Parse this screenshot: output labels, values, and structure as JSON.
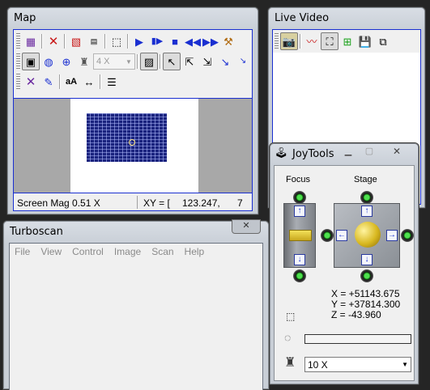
{
  "map_window": {
    "title": "Map",
    "combo_mag": "4 X",
    "status_mag": "Screen Mag 0.51 X",
    "status_xy_label": "XY = [",
    "status_xy_value": "123.247,",
    "status_xy_tail": "7"
  },
  "live_video": {
    "title": "Live Video"
  },
  "turboscan": {
    "title": "Turboscan",
    "menu": [
      "File",
      "View",
      "Control",
      "Image",
      "Scan",
      "Help"
    ]
  },
  "joytools": {
    "title": "JoyTools",
    "focus_label": "Focus",
    "stage_label": "Stage",
    "x_readout": "X = +51143.675",
    "y_readout": "Y = +37814.300",
    "z_readout": "Z = -43.960",
    "objective_value": "10 X"
  },
  "colors": {
    "led_green": "#2fbf2f",
    "scan_blue": "#1a237e",
    "selection_border": "#1a2fd1"
  }
}
